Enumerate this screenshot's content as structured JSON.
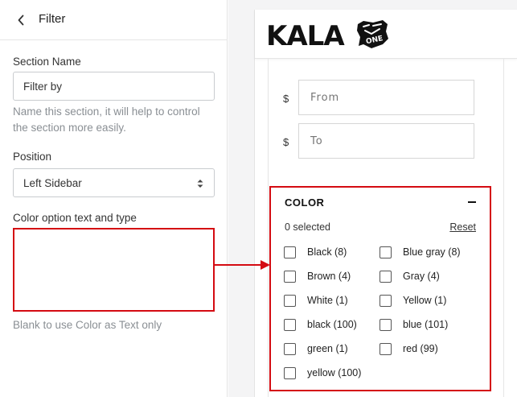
{
  "panel": {
    "title": "Filter",
    "section_name_label": "Section Name",
    "section_name_value": "Filter by",
    "section_name_help": "Name this section, it will help to control the section more easily.",
    "position_label": "Position",
    "position_value": "Left Sidebar",
    "color_option_label": "Color option text and type",
    "color_option_value": "",
    "color_option_help": "Blank to use Color as Text only"
  },
  "preview": {
    "logo_text": "KALA",
    "currency_symbol": "$",
    "from_placeholder": "From",
    "to_placeholder": "To",
    "color_filter": {
      "title": "COLOR",
      "selected_text": "0 selected",
      "reset_label": "Reset",
      "options": [
        {
          "label": "Black (8)",
          "checked": false
        },
        {
          "label": "Blue gray (8)",
          "checked": false
        },
        {
          "label": "Brown (4)",
          "checked": false
        },
        {
          "label": "Gray (4)",
          "checked": false
        },
        {
          "label": "White (1)",
          "checked": false
        },
        {
          "label": "Yellow (1)",
          "checked": false
        },
        {
          "label": "black (100)",
          "checked": false
        },
        {
          "label": "blue (101)",
          "checked": false
        },
        {
          "label": "green (1)",
          "checked": false
        },
        {
          "label": "red (99)",
          "checked": false
        },
        {
          "label": "yellow (100)",
          "checked": false
        }
      ]
    }
  },
  "colors": {
    "highlight": "#d40b12",
    "gutter": "#f4f4f5"
  },
  "icons": {
    "back": "chevron-left-icon",
    "select": "select-arrows-icon",
    "collapse": "minus-icon",
    "connector": "arrow-right-icon"
  }
}
